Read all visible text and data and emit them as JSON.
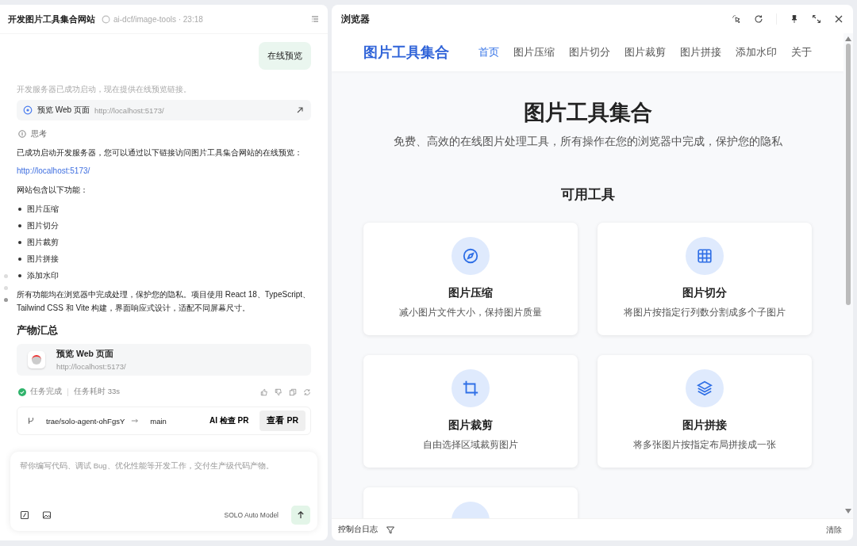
{
  "chat": {
    "title": "开发图片工具集合网站",
    "repo": "ai-dcf/image-tools · 23:18",
    "user_message": "在线预览",
    "status_note": "开发服务器已成功启动，现在提供在线预览链接。",
    "preview_link": {
      "label": "预览 Web 页面",
      "url": "http://localhost:5173/"
    },
    "thinking": "思考",
    "intro": "已成功启动开发服务器，您可以通过以下链接访问图片工具集合网站的在线预览：",
    "link": "http://localhost:5173/",
    "features_heading": "网站包含以下功能：",
    "features": [
      "图片压缩",
      "图片切分",
      "图片裁剪",
      "图片拼接",
      "添加水印"
    ],
    "summary": "所有功能均在浏览器中完成处理，保护您的隐私。项目使用 React 18、TypeScript、Tailwind CSS 和 Vite 构建，界面响应式设计，适配不同屏幕尺寸。",
    "artifacts_heading": "产物汇总",
    "artifact": {
      "title": "预览 Web 页面",
      "url": "http://localhost:5173/"
    },
    "task_status": "任务完成",
    "duration": "任务耗时 33s",
    "branch": {
      "source": "trae/solo-agent-ohFgsY",
      "target": "main"
    },
    "ai_review_button": "AI 检查 PR",
    "view_pr_button": "查看 PR",
    "composer": {
      "placeholder": "帮你编写代码、调试 Bug、优化性能等开发工作，交付生产级代码产物。",
      "model": "SOLO Auto Model"
    }
  },
  "browser": {
    "title": "浏览器",
    "site": {
      "logo": "图片工具集合",
      "nav": [
        {
          "label": "首页",
          "selected": true
        },
        {
          "label": "图片压缩",
          "selected": false
        },
        {
          "label": "图片切分",
          "selected": false
        },
        {
          "label": "图片裁剪",
          "selected": false
        },
        {
          "label": "图片拼接",
          "selected": false
        },
        {
          "label": "添加水印",
          "selected": false
        },
        {
          "label": "关于",
          "selected": false
        }
      ],
      "hero_title": "图片工具集合",
      "hero_subtitle": "免费、高效的在线图片处理工具，所有操作在您的浏览器中完成，保护您的隐私",
      "section_title": "可用工具",
      "tools": [
        {
          "kind": "compress",
          "title": "图片压缩",
          "description": "减小图片文件大小，保持图片质量"
        },
        {
          "kind": "split",
          "title": "图片切分",
          "description": "将图片按指定行列数分割成多个子图片"
        },
        {
          "kind": "crop",
          "title": "图片裁剪",
          "description": "自由选择区域裁剪图片"
        },
        {
          "kind": "merge",
          "title": "图片拼接",
          "description": "将多张图片按指定布局拼接成一张"
        }
      ]
    },
    "console": {
      "label": "控制台日志",
      "clear_button": "清除"
    }
  }
}
